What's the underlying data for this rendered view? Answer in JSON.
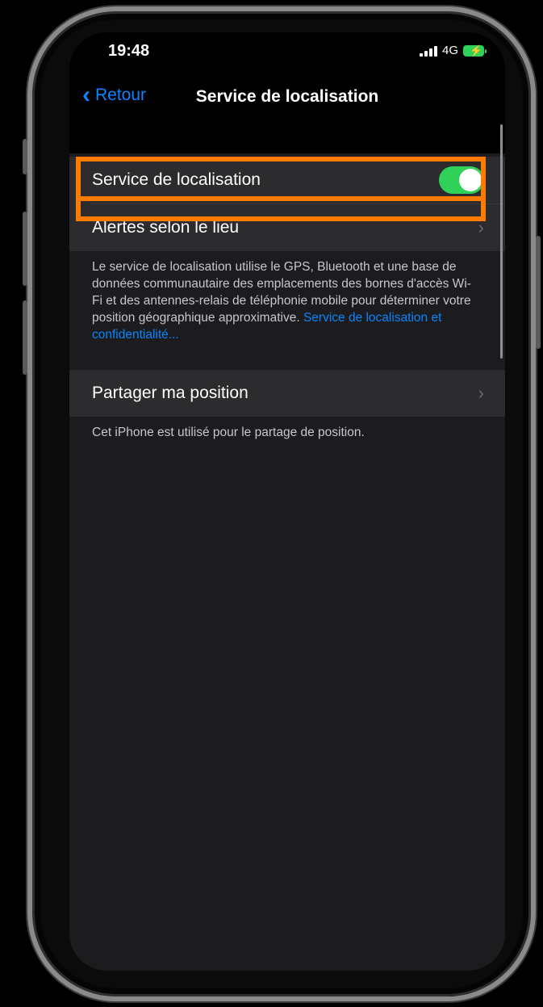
{
  "status_bar": {
    "time": "19:48",
    "network": "4G"
  },
  "nav": {
    "back_label": "Retour",
    "title": "Service de localisation"
  },
  "section1": {
    "location_service_label": "Service de localisation",
    "location_service_enabled": true,
    "location_alerts_label": "Alertes selon le lieu",
    "footnote_text": "Le service de localisation utilise le GPS, Bluetooth et une base de données communautaire des emplacements des bornes d'accès Wi-Fi et des antennes-relais de téléphonie mobile pour déterminer votre position géographique approximative. ",
    "footnote_link": "Service de localisation et confidentialité..."
  },
  "section2": {
    "share_position_label": "Partager ma position",
    "footnote_text": "Cet iPhone est utilisé pour le partage de position."
  },
  "colors": {
    "accent": "#0a84ff",
    "toggle_on": "#30d158",
    "highlight": "#ff7a00"
  }
}
